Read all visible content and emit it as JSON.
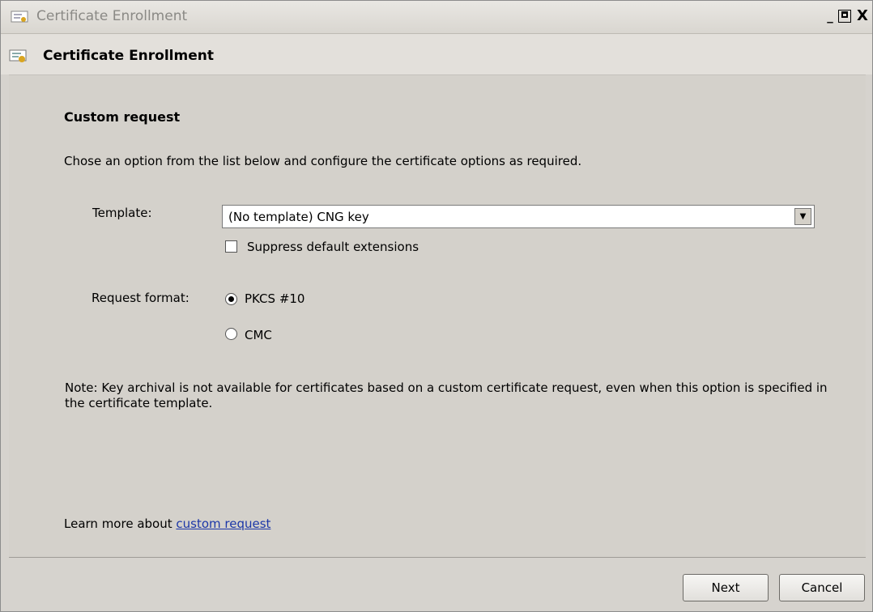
{
  "window": {
    "title": "Certificate Enrollment",
    "controls": {
      "minimize": "_",
      "maximize": "□",
      "close": "X"
    }
  },
  "header": {
    "title": "Certificate Enrollment"
  },
  "main": {
    "section_title": "Custom request",
    "instructions": "Chose an option from the list below and configure the certificate options as required.",
    "template": {
      "label": "Template:",
      "selected": "(No template) CNG key"
    },
    "suppress_checkbox": {
      "label": "Suppress default extensions",
      "checked": false
    },
    "request_format": {
      "label": "Request format:",
      "options": [
        {
          "label": "PKCS #10",
          "selected": true
        },
        {
          "label": "CMC",
          "selected": false
        }
      ]
    },
    "note": "Note: Key archival is not available for certificates based on a custom certificate request, even when this option is specified in the certificate template.",
    "learn_more": {
      "prefix": "Learn more about ",
      "link": "custom request"
    }
  },
  "footer": {
    "next_label": "Next",
    "cancel_label": "Cancel"
  },
  "colors": {
    "window_bg": "#d6d3ce",
    "link": "#1c37a8",
    "icon_accent": "#d9a520"
  },
  "icons": [
    "certificate-icon",
    "dropdown-arrow-icon"
  ]
}
